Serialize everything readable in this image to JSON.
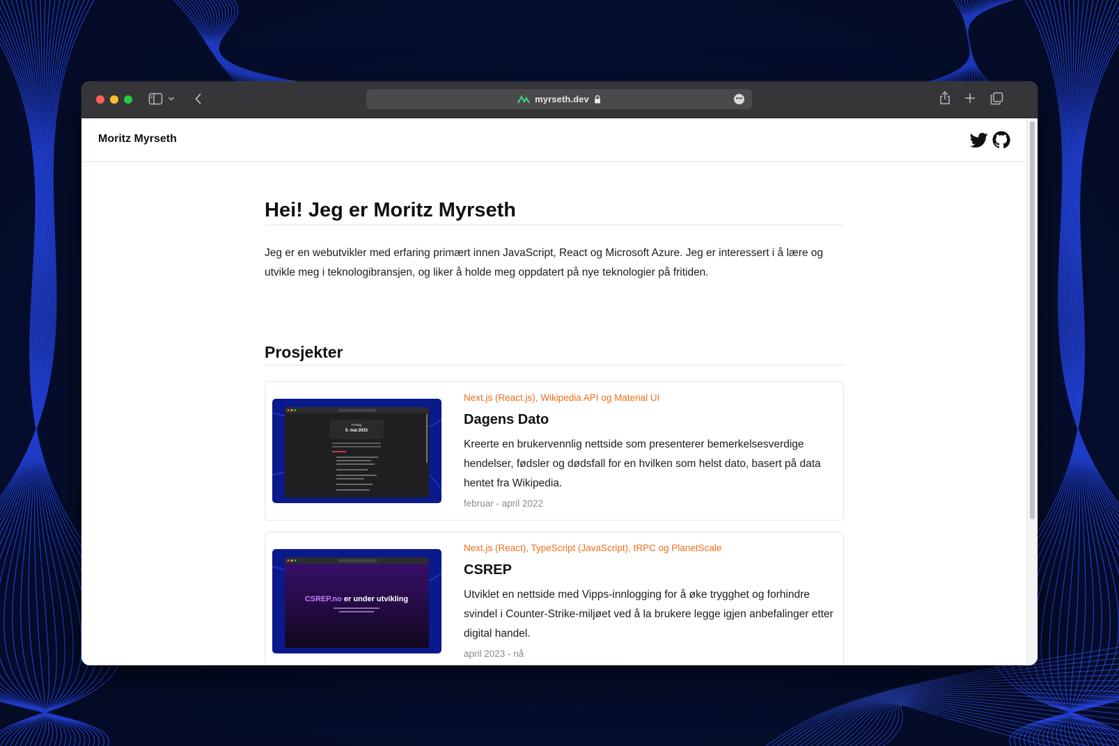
{
  "browser": {
    "url": "myrseth.dev"
  },
  "site": {
    "brand": "Moritz Myrseth",
    "hero_title": "Hei! Jeg er Moritz Myrseth",
    "intro": "Jeg er en webutvikler med erfaring primært innen JavaScript, React og Microsoft Azure. Jeg er interessert i å lære og utvikle meg i teknologibransjen, og liker å holde meg oppdatert på nye teknologier på fritiden.",
    "projects_heading": "Prosjekter"
  },
  "projects": [
    {
      "tags": "Next.js (React.js), Wikipedia API og Material UI",
      "title": "Dagens Dato",
      "description": "Kreerte en brukervennlig nettside som presenterer bemerkelsesverdige hendelser, fødsler og dødsfall for en hvilken som helst dato, basert på data hentet fra Wikipedia.",
      "date": "februar - april 2022",
      "thumb": {
        "heading": "Fredag",
        "date": "5. mai 2023"
      }
    },
    {
      "tags": "Next.js (React), TypeScript (JavaScript), tRPC og PlanetScale",
      "title": "CSREP",
      "description": "Utviklet en nettside med Vipps-innlogging for å øke trygghet og forhindre svindel i Counter-Strike-miljøet ved å la brukere legge igjen anbefalinger etter digital handel.",
      "date": "april 2023 - nå",
      "thumb": {
        "brand": "CSREP.no",
        "text": " er under utvikling"
      }
    }
  ],
  "icons": {
    "site_icon": "mountain-icon",
    "lock": "lock-icon",
    "more": "ellipsis-icon",
    "sidebar": "sidebar-icon",
    "chevron": "chevron-down-icon",
    "back": "back-arrow-icon",
    "share": "share-icon",
    "new_tab": "plus-icon",
    "tabs": "tab-overview-icon",
    "twitter": "twitter-icon",
    "github": "github-icon"
  },
  "colors": {
    "accent": "#f06d1a",
    "wallpaper": "#040d2e",
    "titlebar": "#363638"
  }
}
